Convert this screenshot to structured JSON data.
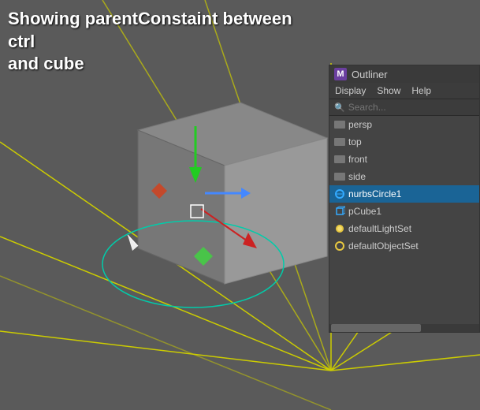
{
  "title": "Showing parentConstaint between ctrl\nand cube",
  "viewport": {
    "background": "#5a5a5a"
  },
  "outliner": {
    "title": "Outliner",
    "m_label": "M",
    "menu": {
      "display": "Display",
      "show": "Show",
      "help": "Help"
    },
    "search_placeholder": "Search...",
    "items": [
      {
        "label": "persp",
        "type": "camera",
        "selected": false
      },
      {
        "label": "top",
        "type": "camera",
        "selected": false
      },
      {
        "label": "front",
        "type": "camera",
        "selected": false
      },
      {
        "label": "side",
        "type": "camera",
        "selected": false
      },
      {
        "label": "nurbsCircle1",
        "type": "nurbs",
        "selected": true
      },
      {
        "label": "pCube1",
        "type": "cube",
        "selected": false
      },
      {
        "label": "defaultLightSet",
        "type": "lightset",
        "selected": false
      },
      {
        "label": "defaultObjectSet",
        "type": "objectset",
        "selected": false
      }
    ]
  }
}
